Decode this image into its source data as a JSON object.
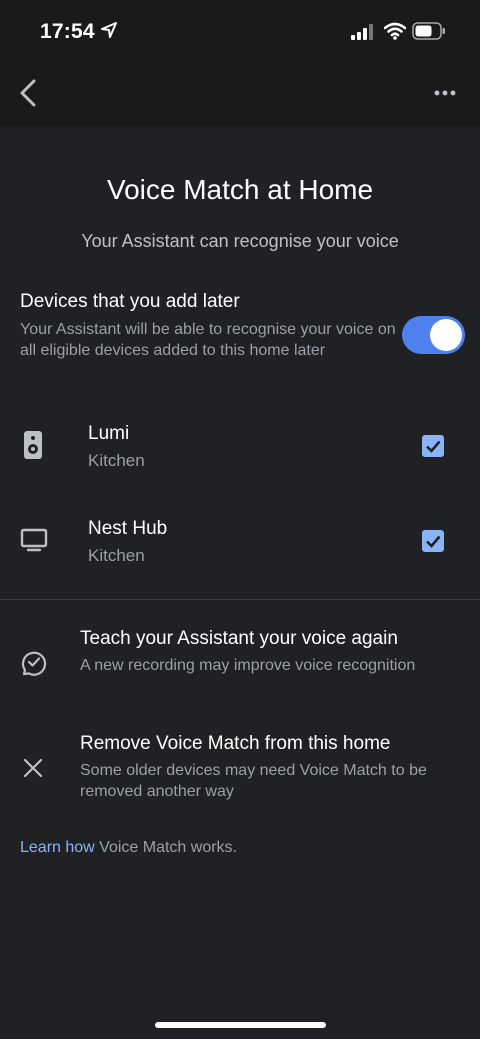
{
  "status_bar": {
    "time": "17:54"
  },
  "header": {
    "title": "Voice Match at Home",
    "subtitle": "Your Assistant can recognise your voice"
  },
  "later_devices": {
    "heading": "Devices that you add later",
    "description": "Your Assistant will be able to recognise your voice on all eligible devices added to this home later",
    "toggle_on": true
  },
  "devices": [
    {
      "name": "Lumi",
      "room": "Kitchen",
      "icon": "speaker-icon",
      "checked": true
    },
    {
      "name": "Nest Hub",
      "room": "Kitchen",
      "icon": "display-icon",
      "checked": true
    }
  ],
  "actions": [
    {
      "title": "Teach your Assistant your voice again",
      "description": "A new recording may improve voice recognition",
      "icon": "voice-check-icon"
    },
    {
      "title": "Remove Voice Match from this home",
      "description": "Some older devices may need Voice Match to be removed another way",
      "icon": "close-icon"
    }
  ],
  "footer": {
    "link_text": "Learn how",
    "text": " Voice Match works."
  },
  "colors": {
    "accent": "#8ab4f8",
    "toggle": "#4e80ee",
    "background": "#202124",
    "bar": "#1a1a1a"
  }
}
